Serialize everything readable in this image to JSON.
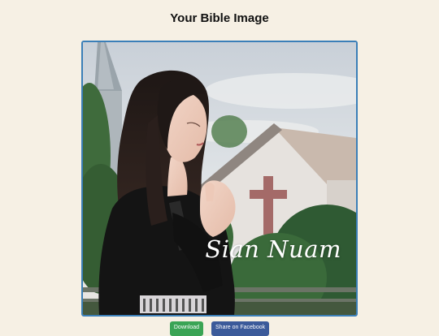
{
  "page": {
    "title": "Your Bible Image"
  },
  "image": {
    "watermark_text": "Sian Nuam",
    "frame_color": "#3b7fb8"
  },
  "actions": {
    "download_label": "Download",
    "share_label": "Share on Facebook",
    "download_color": "#3aa455",
    "share_color": "#3b5a9a"
  }
}
